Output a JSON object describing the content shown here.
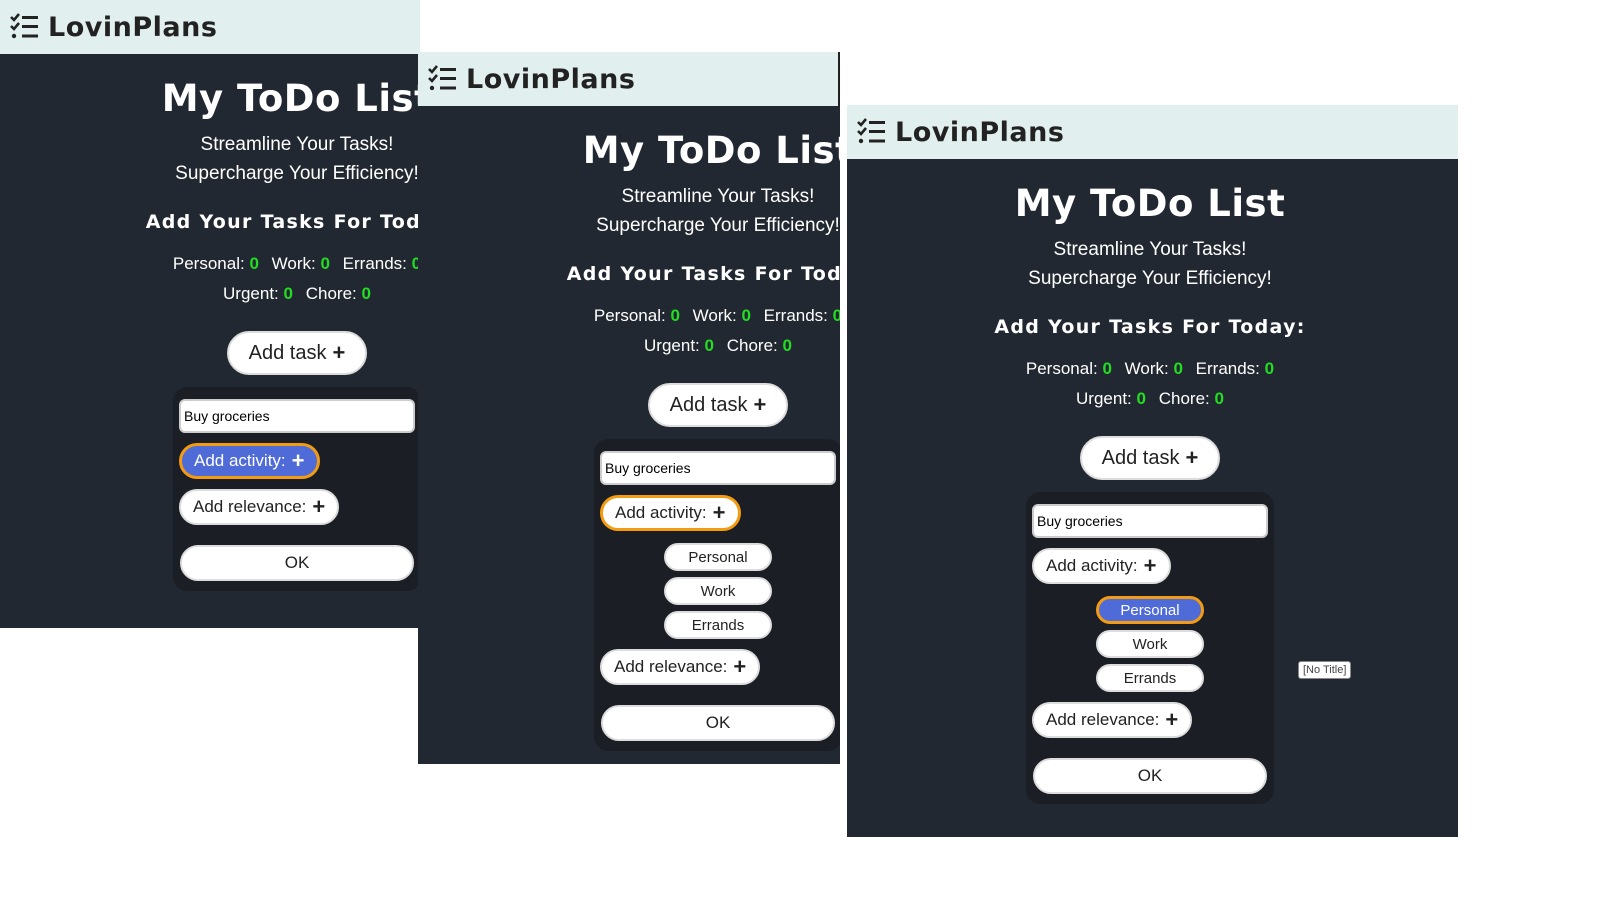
{
  "brand": "LovinPlans",
  "title": "My ToDo List",
  "tagline": [
    "Streamline Your Tasks!",
    "Supercharge Your Efficiency!"
  ],
  "subtitle": "Add Your Tasks For Today",
  "subtitle_colon": "Add Your Tasks For Today:",
  "counts": {
    "personal_label": "Personal:",
    "personal": "0",
    "work_label": "Work:",
    "work": "0",
    "errands_label": "Errands:",
    "errands": "0",
    "urgent_label": "Urgent:",
    "urgent": "0",
    "chore_label": "Chore:",
    "chore": "0"
  },
  "add_task_label": "Add task",
  "task_input_value": "Buy groceries",
  "add_activity_label": "Add activity:",
  "add_relevance_label": "Add relevance:",
  "activities": [
    "Personal",
    "Work",
    "Errands"
  ],
  "ok_label": "OK",
  "tooltip": "[No Title]",
  "colors": {
    "header_bg": "#e1f0ef",
    "app_bg": "#222831",
    "count_green": "#22dd22",
    "active_blue": "#4f6bd8",
    "focus_orange": "#f39c12"
  }
}
